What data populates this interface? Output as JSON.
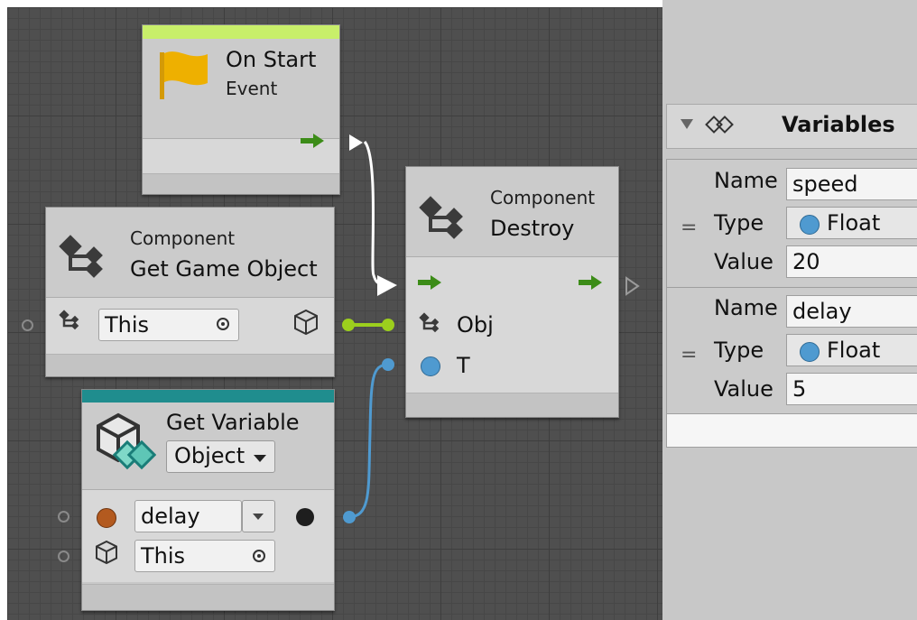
{
  "graph": {
    "on_start": {
      "title": "On Start",
      "subtitle": "Event",
      "color": "#c8ef6a"
    },
    "get_game_object": {
      "category": "Component",
      "title": "Get Game Object",
      "target_value": "This"
    },
    "destroy": {
      "category": "Component",
      "title": "Destroy",
      "obj_label": "Obj",
      "t_label": "T"
    },
    "get_variable": {
      "title": "Get Variable",
      "kind": "Object",
      "variable": "delay",
      "target_value": "This",
      "color": "#1f8d8e"
    },
    "colors": {
      "flow": "#3c8c18",
      "object_port": "#9ccf1d",
      "float_port": "#4f9ad0",
      "variable_dot": "#b35a1f"
    }
  },
  "variables_panel": {
    "title": "Variables",
    "labels": {
      "name": "Name",
      "type": "Type",
      "value": "Value"
    },
    "items": [
      {
        "name": "speed",
        "type": "Float",
        "value": "20"
      },
      {
        "name": "delay",
        "type": "Float",
        "value": "5"
      }
    ]
  }
}
